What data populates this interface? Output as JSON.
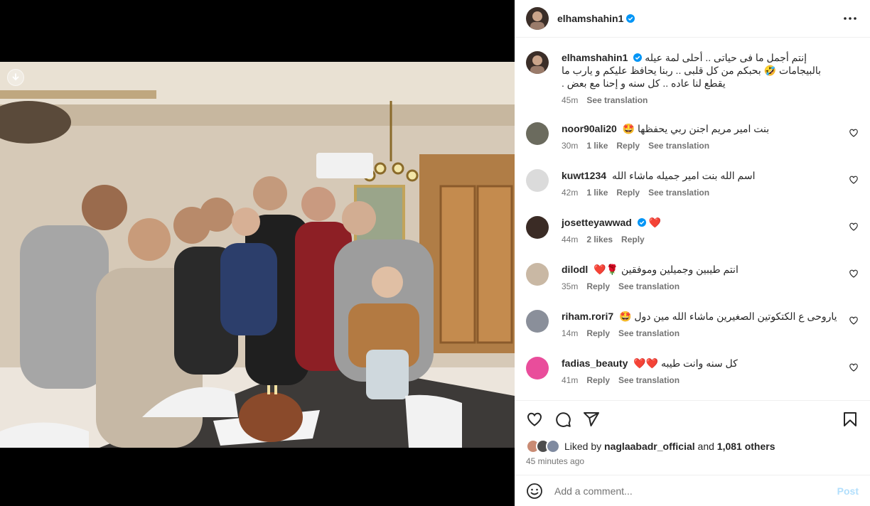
{
  "post": {
    "author": "elhamshahin1",
    "caption": "إنتم أجمل ما فى حياتى .. أحلى لمة عيله بالبيجامات 🤣 بحبكم من كل قلبى .. ربنا يحافظ عليكم و يارب ما يقطع لنا عاده .. كل سنه و إحنا مع بعض .",
    "caption_time": "45m",
    "see_translation": "See translation"
  },
  "comments": [
    {
      "user": "noor90ali20",
      "text": "بنت امير مريم اجنن ربي يحفظها 🤩",
      "time": "30m",
      "likes": "1 like",
      "reply": "Reply",
      "translate": "See translation",
      "avatar_color": "#6b6b5e"
    },
    {
      "user": "kuwt1234",
      "text": "اسم الله بنت امير جميله ماشاء الله",
      "time": "42m",
      "likes": "1 like",
      "reply": "Reply",
      "translate": "See translation",
      "avatar_color": "#dbdbdb"
    },
    {
      "user": "josetteyawwad",
      "text": "❤️",
      "time": "44m",
      "likes": "2 likes",
      "reply": "Reply",
      "translate": "",
      "avatar_color": "#3a2b25",
      "verified": true
    },
    {
      "user": "dilodl",
      "text": "انتم طيبين وجميلين وموفقين 🌹❤️",
      "time": "35m",
      "likes": "",
      "reply": "Reply",
      "translate": "See translation",
      "avatar_color": "#c9b8a4"
    },
    {
      "user": "riham.rori7",
      "text": "ياروحى ع الكتكوتين الصغيرين ماشاء الله مين دول 🤩",
      "time": "14m",
      "likes": "",
      "reply": "Reply",
      "translate": "See translation",
      "avatar_color": "#8a8f9a"
    },
    {
      "user": "fadias_beauty",
      "text": "كل سنه وانت طيبه ❤️❤️",
      "time": "41m",
      "likes": "",
      "reply": "Reply",
      "translate": "See translation",
      "avatar_color": "#e94d9b"
    }
  ],
  "likes": {
    "prefix": "Liked by",
    "user": "naglaabadr_official",
    "and": "and",
    "others": "1,081 others"
  },
  "time_ago": "45 minutes ago",
  "comment_box": {
    "placeholder": "Add a comment...",
    "post_label": "Post"
  },
  "colors": {
    "verified": "#0095f6",
    "heart": "#ed4956",
    "post_disabled": "#b2dffc"
  },
  "icons": {
    "more": "more-icon",
    "like": "heart-icon",
    "comment": "comment-icon",
    "share": "share-icon",
    "save": "bookmark-icon",
    "emoji": "emoji-icon",
    "download": "download-icon"
  }
}
